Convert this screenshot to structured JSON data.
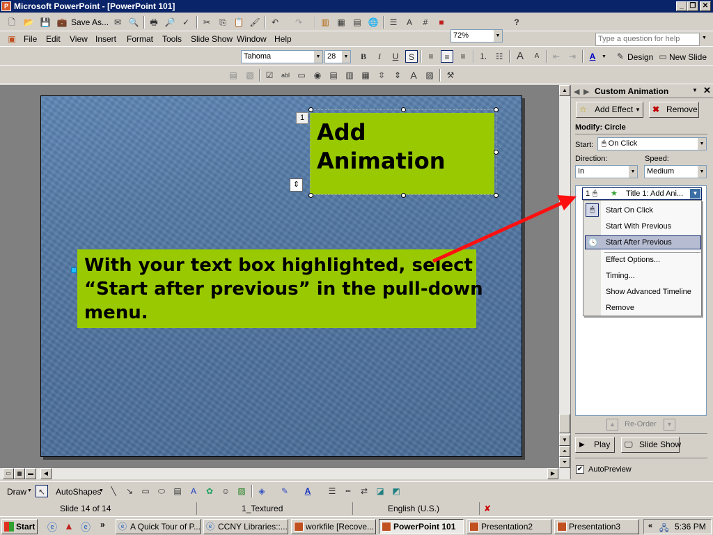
{
  "window": {
    "title": "Microsoft PowerPoint - [PowerPoint 101]",
    "controls": [
      "_",
      "❐",
      "✕"
    ]
  },
  "toolbar1": {
    "save_as_label": "Save As...",
    "zoom_value": "72%",
    "help_label": "?"
  },
  "menubar": {
    "items": [
      "File",
      "Edit",
      "View",
      "Insert",
      "Format",
      "Tools",
      "Slide Show",
      "Window",
      "Help"
    ],
    "ask_placeholder": "Type a question for help"
  },
  "formatting": {
    "font_name": "Tahoma",
    "font_size": "28",
    "design_label": "Design",
    "new_slide_label": "New Slide"
  },
  "slide": {
    "title_line1": "Add",
    "title_line2": "Animation",
    "badge": "1",
    "body_text_line1": "With your text box highlighted, select",
    "body_text_line2": "“Start after previous” in the pull-down",
    "body_text_line3": "menu.",
    "box_color": "#99c900",
    "arrow_color": "#ff1010"
  },
  "task_pane": {
    "title": "Custom Animation",
    "add_effect_label": "Add Effect",
    "remove_label": "Remove",
    "modify_label": "Modify: Circle",
    "start_label": "Start:",
    "start_value": "On Click",
    "direction_label": "Direction:",
    "direction_value": "In",
    "speed_label": "Speed:",
    "speed_value": "Medium",
    "effect_item": {
      "index": "1",
      "label": "Title 1: Add Ani..."
    },
    "dropdown_items": [
      "Start On Click",
      "Start With Previous",
      "Start After Previous",
      "Effect Options...",
      "Timing...",
      "Show Advanced Timeline",
      "Remove"
    ],
    "selected_dropdown_index": 2,
    "reorder_label": "Re-Order",
    "play_label": "Play",
    "slideshow_label": "Slide Show",
    "autopreview_label": "AutoPreview",
    "autopreview_checked": true
  },
  "drawing_toolbar": {
    "draw_label": "Draw",
    "autoshapes_label": "AutoShapes"
  },
  "status_bar": {
    "slide_info": "Slide 14 of 14",
    "design": "1_Textured",
    "language": "English (U.S.)"
  },
  "taskbar": {
    "start_label": "Start",
    "tasks": [
      "A Quick Tour of P...",
      "CCNY Libraries::...",
      "workfile [Recove...",
      "PowerPoint 101",
      "Presentation2",
      "Presentation3"
    ],
    "active_task_index": 3,
    "clock": "5:36 PM"
  }
}
